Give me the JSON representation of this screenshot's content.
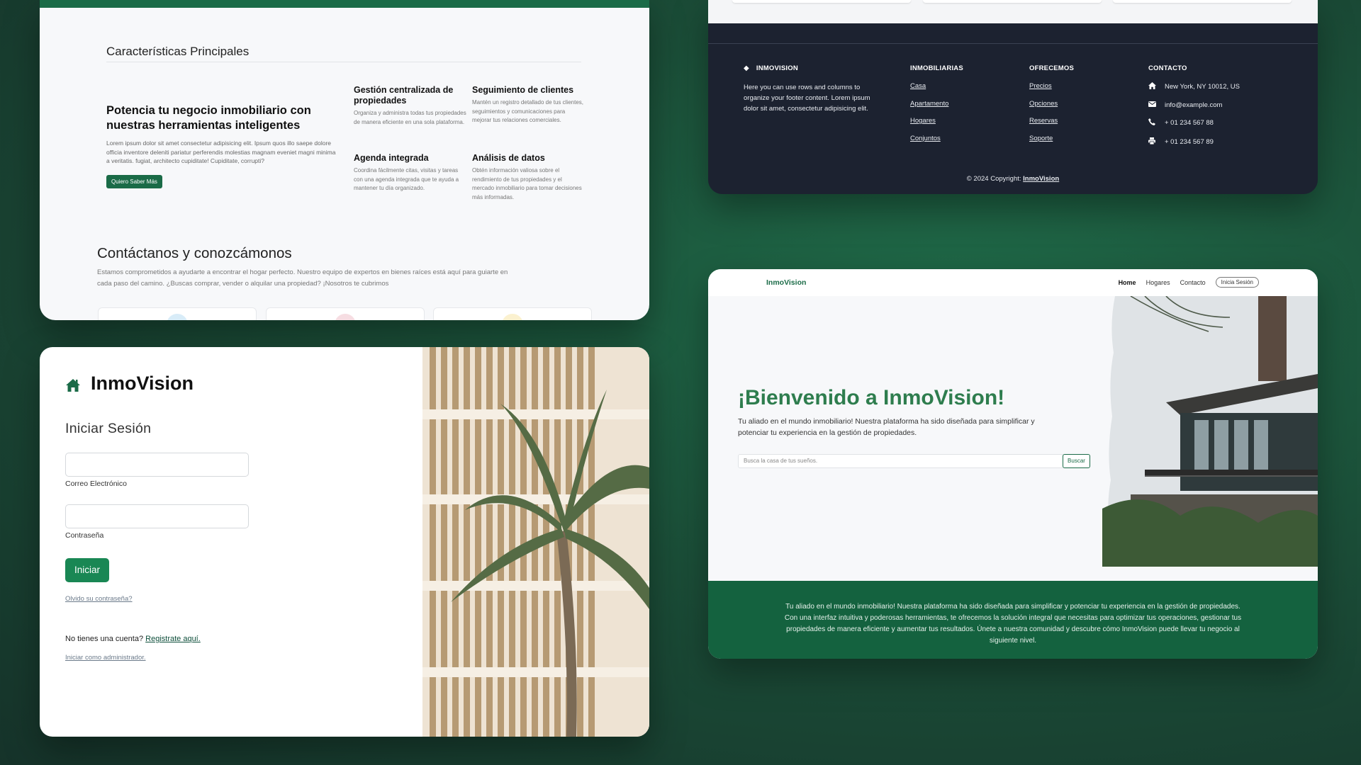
{
  "features_card": {
    "title": "Características Principales",
    "hero_heading": "Potencia tu negocio inmobiliario con nuestras herramientas inteligentes",
    "hero_text": "Lorem ipsum dolor sit amet consectetur adipisicing elit. Ipsum quos illo saepe dolore officia inventore deleniti pariatur perferendis molestias magnam eveniet magni minima a veritatis. fugiat, architecto cupiditate! Cupiditate, corrupti?",
    "hero_button": "Quiero Saber Más",
    "items": [
      {
        "title": "Gestión centralizada de propiedades",
        "text": "Organiza y administra todas tus propiedades de manera eficiente en una sola plataforma."
      },
      {
        "title": "Seguimiento de clientes",
        "text": "Mantén un registro detallado de tus clientes, seguimientos y comunicaciones para mejorar tus relaciones comerciales."
      },
      {
        "title": "Agenda integrada",
        "text": "Coordina fácilmente citas, visitas y tareas con una agenda integrada que te ayuda a mantener tu día organizado."
      },
      {
        "title": "Análisis de datos",
        "text": "Obtén información valiosa sobre el rendimiento de tus propiedades y el mercado inmobiliario para tomar decisiones más informadas."
      }
    ],
    "contact_heading": "Contáctanos y conozcámonos",
    "contact_text": "Estamos comprometidos a ayudarte a encontrar el hogar perfecto. Nuestro equipo de expertos en bienes raíces está aquí para guiarte en cada paso del camino. ¿Buscas comprar, vender o alquilar una propiedad? ¡Nosotros te cubrimos",
    "card_colors": [
      "#d8ecf8",
      "#f6dde2",
      "#fbf1cf"
    ]
  },
  "footer_card": {
    "brand": "INMOVISION",
    "brand_text": "Here you can use rows and columns to organize your footer content. Lorem ipsum dolor sit amet, consectetur adipisicing elit.",
    "col1_title": "INMOBILIARIAS",
    "col1_links": [
      "Casa",
      "Apartamento",
      "Hogares",
      "Conjuntos"
    ],
    "col2_title": "OFRECEMOS",
    "col2_links": [
      "Precios",
      "Opciones",
      "Reservas",
      "Soporte"
    ],
    "col3_title": "CONTACTO",
    "contact": [
      {
        "icon": "home-icon",
        "text": "New York, NY 10012, US"
      },
      {
        "icon": "envelope-icon",
        "text": "info@example.com"
      },
      {
        "icon": "phone-icon",
        "text": "+ 01 234 567 88"
      },
      {
        "icon": "print-icon",
        "text": "+ 01 234 567 89"
      }
    ],
    "copyright_prefix": "© 2024 Copyright: ",
    "copyright_brand": "InmoVision"
  },
  "login_card": {
    "brand": "InmoVision",
    "title": "Iniciar Sesión",
    "email_label": "Correo Electrónico",
    "password_label": "Contraseña",
    "submit": "Iniciar",
    "forgot": "Olvido su contraseña?",
    "no_account": "No tienes una cuenta? ",
    "register": "Registrate aquí.",
    "admin": "Iniciar como administrador."
  },
  "home_card": {
    "logo": "InmoVision",
    "nav": [
      "Home",
      "Hogares",
      "Contacto"
    ],
    "login_pill": "Inicia Sesión",
    "title": "¡Bienvenido a InmoVision!",
    "subtitle": "Tu aliado en el mundo inmobiliario! Nuestra plataforma ha sido diseñada para simplificar y potenciar tu experiencia en la gestión de propiedades.",
    "search_placeholder": "Busca la casa de tus sueños.",
    "search_button": "Buscar",
    "band_text": "Tu aliado en el mundo inmobiliario! Nuestra plataforma ha sido diseñada para simplificar y potenciar tu experiencia en la gestión de propiedades. Con una interfaz intuitiva y poderosas herramientas, te ofrecemos la solución integral que necesitas para optimizar tus operaciones, gestionar tus propiedades de manera eficiente y aumentar tus resultados. Únete a nuestra comunidad y descubre cómo InmoVision puede llevar tu negocio al siguiente nivel."
  },
  "colors": {
    "brand_green": "#1a6b47",
    "button_green": "#198754",
    "footer_bg": "#1c2230",
    "title_green": "#2e7d4e"
  }
}
